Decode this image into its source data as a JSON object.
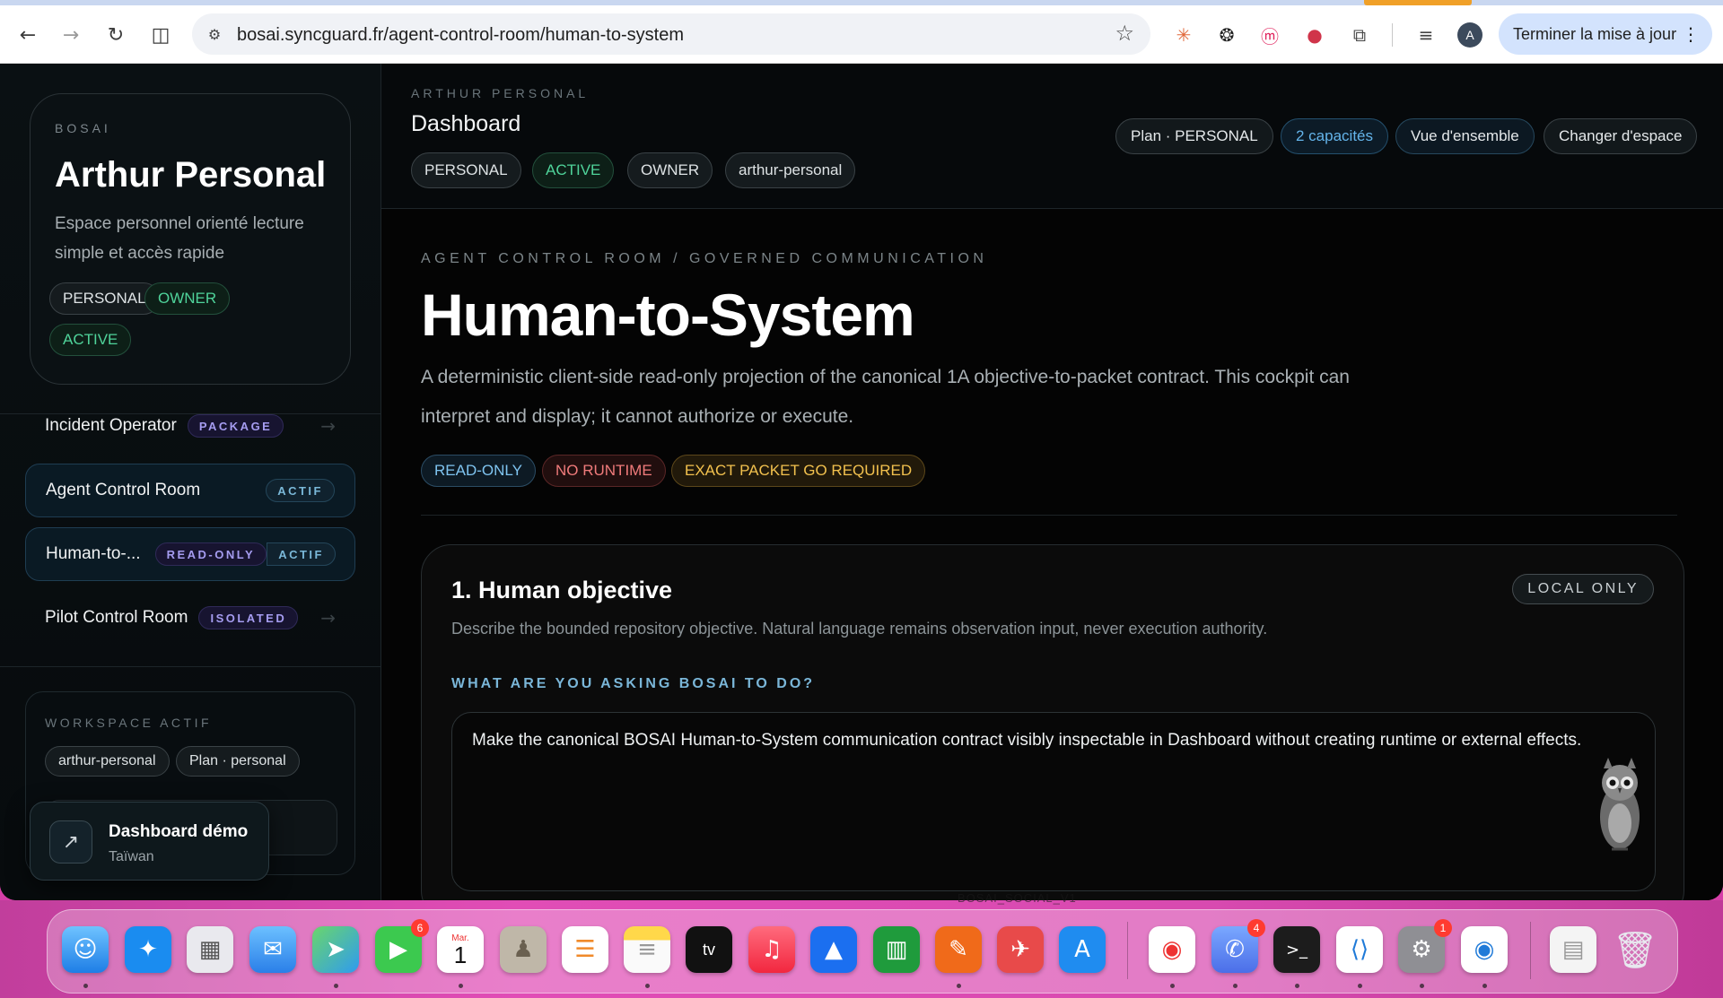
{
  "browser": {
    "url": "bosai.syncguard.fr/agent-control-room/human-to-system",
    "update_button": "Terminer la mise à jour",
    "profile_initial": "A"
  },
  "sidebar": {
    "workspace": {
      "kicker": "BOSAI",
      "name": "Arthur Personal",
      "description": "Espace personnel orienté lecture simple et accès rapide",
      "tags": [
        "PERSONAL",
        "OWNER",
        "ACTIVE"
      ]
    },
    "nav": [
      {
        "label": "Incident Operator",
        "tag": "PACKAGE"
      },
      {
        "label": "Agent Control Room",
        "tag": "ACTIF"
      },
      {
        "label": "Human-to-...",
        "tag": "READ-ONLY",
        "tag2": "ACTIF"
      },
      {
        "label": "Pilot Control Room",
        "tag": "ISOLATED"
      }
    ],
    "workspace_actif": {
      "kicker": "WORKSPACE ACTIF",
      "chips": [
        "arthur-personal",
        "Plan · personal"
      ]
    },
    "demo": {
      "title": "Dashboard démo",
      "subtitle": "Taïwan"
    }
  },
  "topbar": {
    "kicker": "ARTHUR PERSONAL",
    "title": "Dashboard",
    "chips": [
      "PERSONAL",
      "ACTIVE",
      "OWNER",
      "arthur-personal"
    ],
    "actions": [
      "Plan · PERSONAL",
      "2 capacités",
      "Vue d'ensemble",
      "Changer d'espace"
    ]
  },
  "main": {
    "kicker": "AGENT CONTROL ROOM / GOVERNED COMMUNICATION",
    "title": "Human-to-System",
    "lead": "A deterministic client-side read-only projection of the canonical 1A objective-to-packet contract. This cockpit can interpret and display; it cannot authorize or execute.",
    "badges": [
      "READ-ONLY",
      "NO RUNTIME",
      "EXACT PACKET GO REQUIRED"
    ],
    "panel": {
      "title": "1. Human objective",
      "description": "Describe the bounded repository objective. Natural language remains observation input, never execution authority.",
      "scope_badge": "LOCAL ONLY",
      "question": "WHAT ARE YOU ASKING BOSAI TO DO?",
      "objective_value": "Make the canonical BOSAI Human-to-System communication contract visibly inspectable in Dashboard without creating runtime or external effects."
    }
  },
  "dock": {
    "label": "BOSAI_SOCIAL_V1",
    "badges": {
      "facetime": "6",
      "messages_app": "4",
      "settings": "1"
    },
    "calendar": {
      "month": "Mar.",
      "day": "1"
    }
  },
  "colors": {
    "accent_green": "#4fd39a",
    "accent_blue": "#64b4ea",
    "accent_red": "#f07b7b",
    "accent_amber": "#f2c14e",
    "tag_purple": "#a59cf0"
  }
}
